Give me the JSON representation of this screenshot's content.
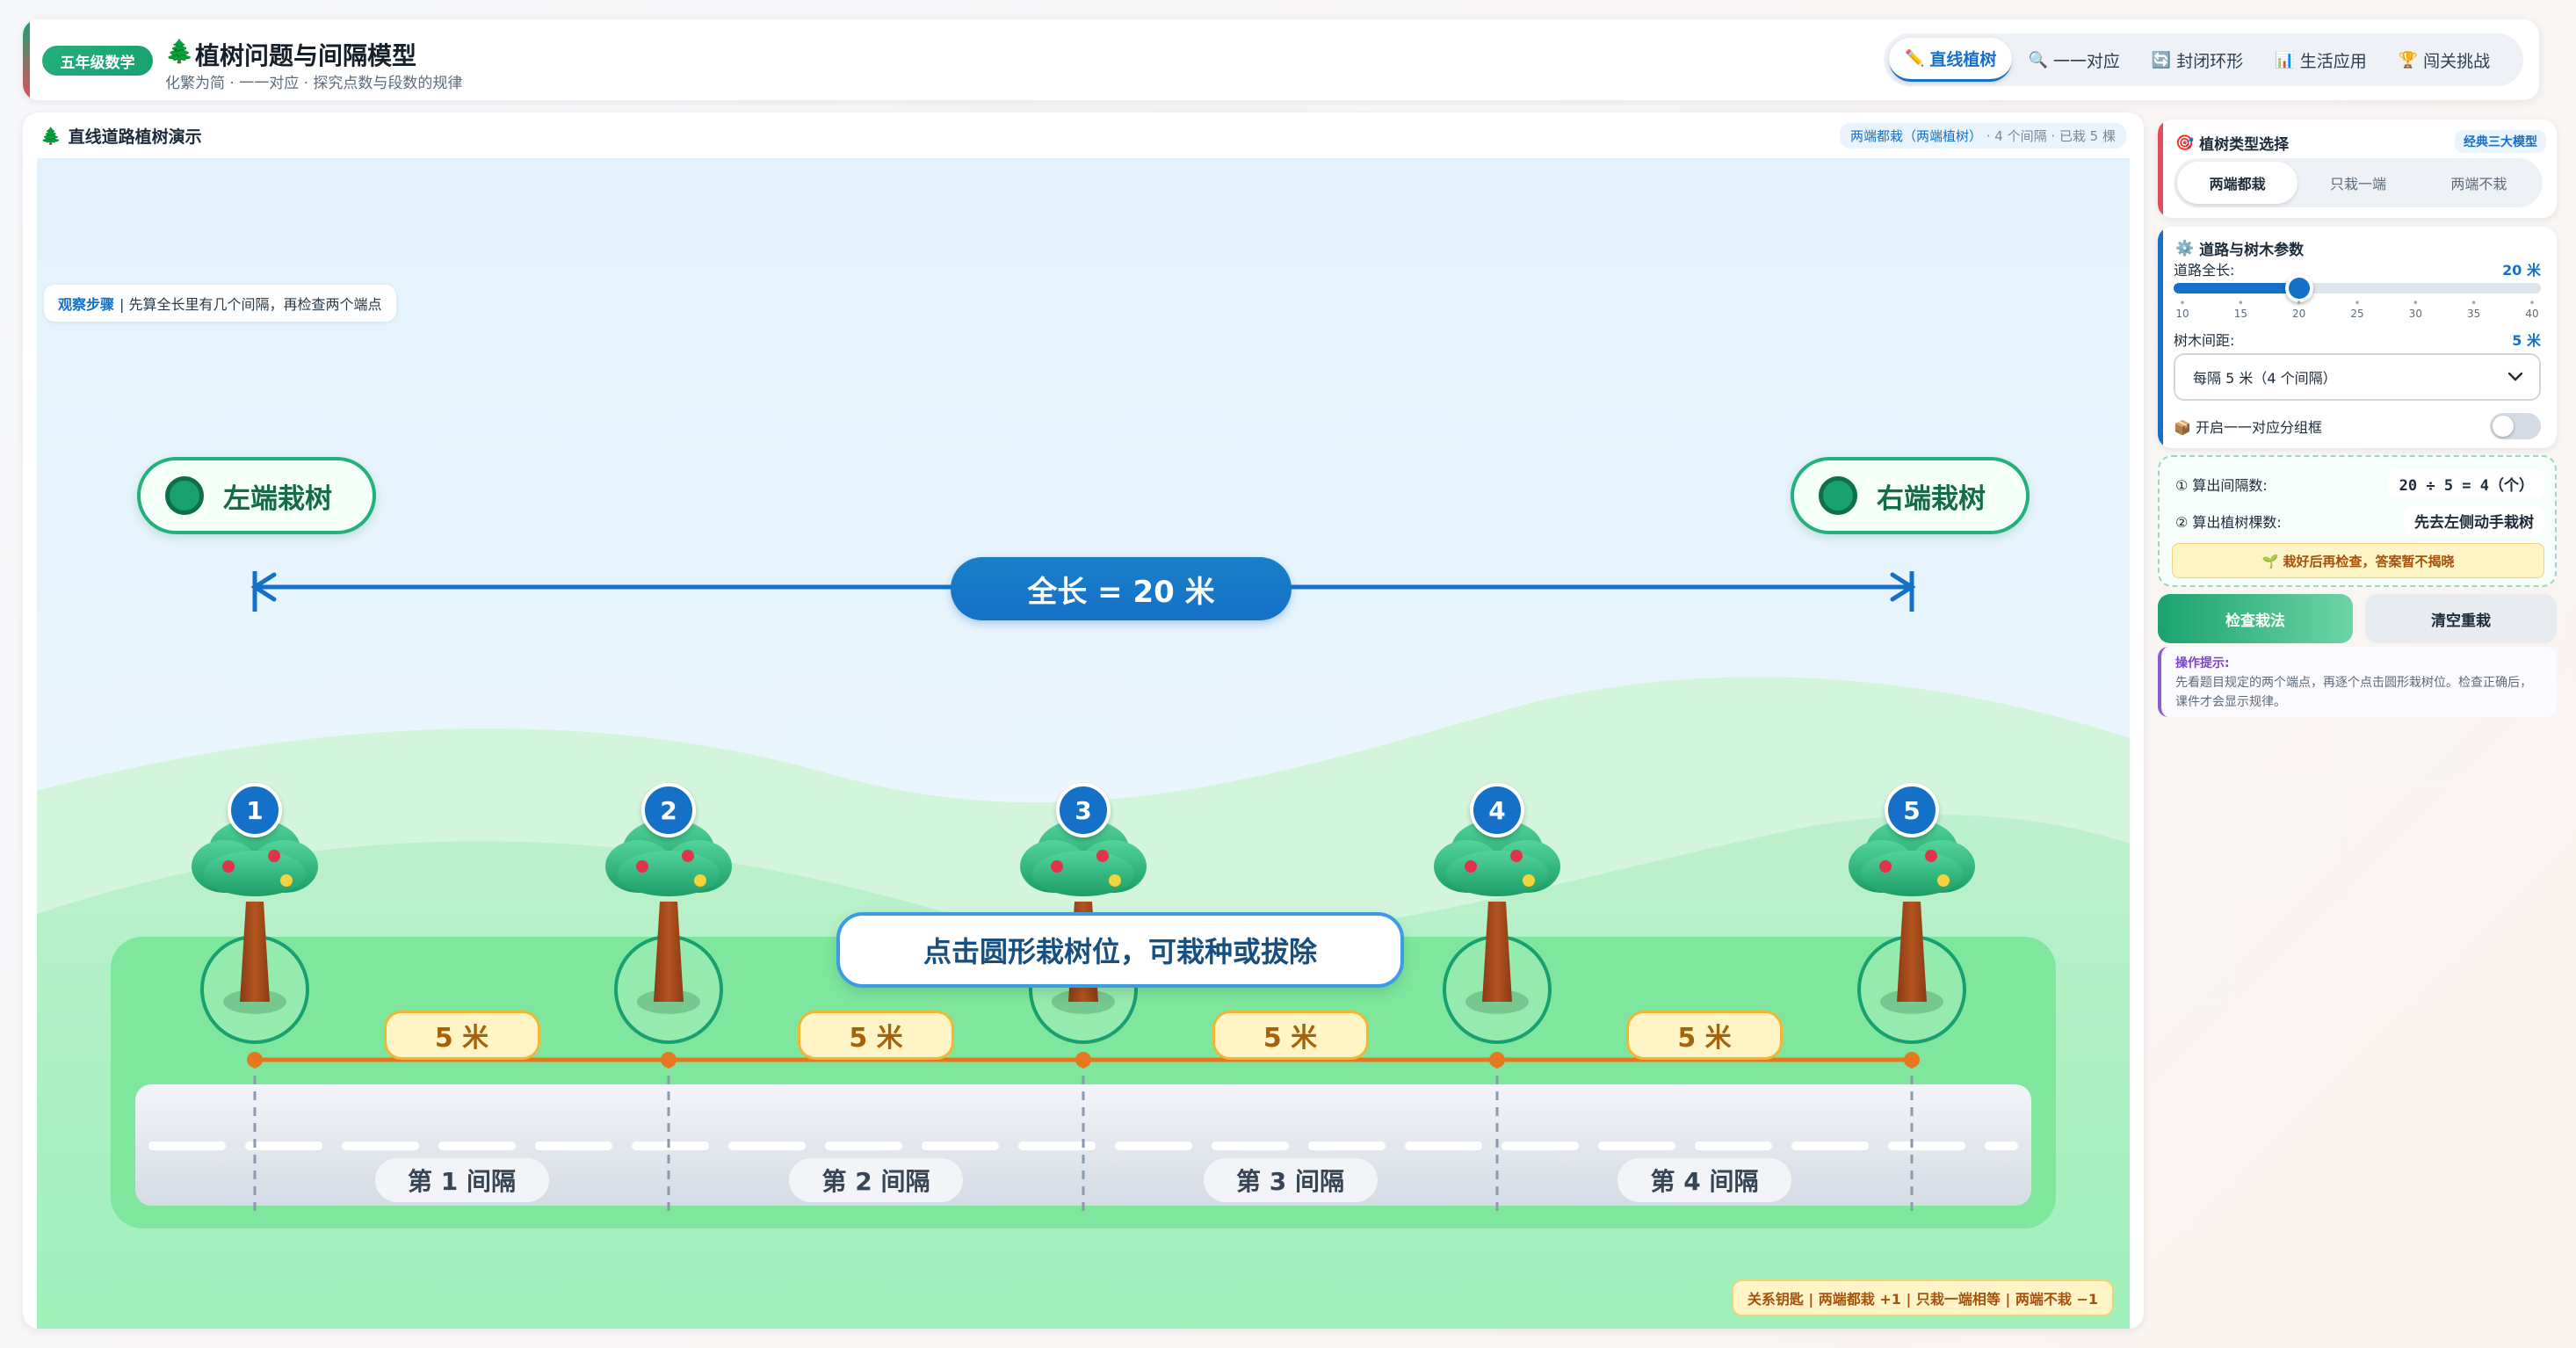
{
  "header": {
    "grade_badge": "五年级数学",
    "title_icon": "🌲",
    "title": "植树问题与间隔模型",
    "subtitle": "化繁为简 · 一一对应 · 探究点数与段数的规律",
    "tabs": [
      {
        "icon": "✏️",
        "label": "直线植树",
        "active": true
      },
      {
        "icon": "🔍",
        "label": "一一对应",
        "active": false
      },
      {
        "icon": "🔄",
        "label": "封闭环形",
        "active": false
      },
      {
        "icon": "📊",
        "label": "生活应用",
        "active": false
      },
      {
        "icon": "🏆",
        "label": "闯关挑战",
        "active": false
      }
    ]
  },
  "stage": {
    "title_icon": "🌲",
    "title": "直线道路植树演示",
    "status_mode": "两端都栽（两端植树）",
    "status_detail": " · 4 个间隔 · 已栽 5 棵",
    "observe_label": "观察步骤",
    "observe_text": "| 先算全长里有几个间隔，再检查两个端点",
    "left_end": "左端栽树",
    "right_end": "右端栽树",
    "total_length": "全长 = 20 米",
    "hint": "点击圆形栽树位，可栽种或拔除",
    "tree_numbers": [
      "1",
      "2",
      "3",
      "4",
      "5"
    ],
    "gap_labels": [
      "5 米",
      "5 米",
      "5 米",
      "5 米"
    ],
    "segment_labels": [
      "第 1 间隔",
      "第 2 间隔",
      "第 3 间隔",
      "第 4 间隔"
    ],
    "key_text": "关系钥匙 | 两端都栽 +1 | 只栽一端相等 | 两端不栽 −1"
  },
  "panel_type": {
    "icon": "🎯",
    "title": "植树类型选择",
    "badge": "经典三大模型",
    "options": [
      {
        "label": "两端都栽",
        "active": true
      },
      {
        "label": "只栽一端",
        "active": false
      },
      {
        "label": "两端不栽",
        "active": false
      }
    ]
  },
  "panel_params": {
    "icon": "⚙️",
    "title": "道路与树木参数",
    "length_label": "道路全长:",
    "length_value": "20 米",
    "length_fraction": 0.3333,
    "ticks": [
      "10",
      "15",
      "20",
      "25",
      "30",
      "35",
      "40"
    ],
    "spacing_label": "树木间距:",
    "spacing_value": "5 米",
    "spacing_select": "每隔 5 米（4 个间隔）",
    "toggle_icon": "📦",
    "toggle_label": "开启一一对应分组框",
    "toggle_on": false
  },
  "panel_calc": {
    "step1_label": "① 算出间隔数:",
    "step1_value": "20 ÷ 5 = 4（个）",
    "step2_label": "② 算出植树棵数:",
    "step2_value": "先去左侧动手栽树",
    "note": "🌱 栽好后再检查，答案暂不揭晓"
  },
  "buttons": {
    "check": "检查栽法",
    "reset": "清空重栽"
  },
  "tip": {
    "title": "操作提示:",
    "text": "先看题目规定的两个端点，再逐个点击圆形栽树位。检查正确后，课件才会显示规律。"
  },
  "colors": {
    "brand_green": "#1aa36f",
    "brand_blue": "#1570c8",
    "accent_orange": "#e5781e",
    "label_yellow": "#fff4c6"
  }
}
